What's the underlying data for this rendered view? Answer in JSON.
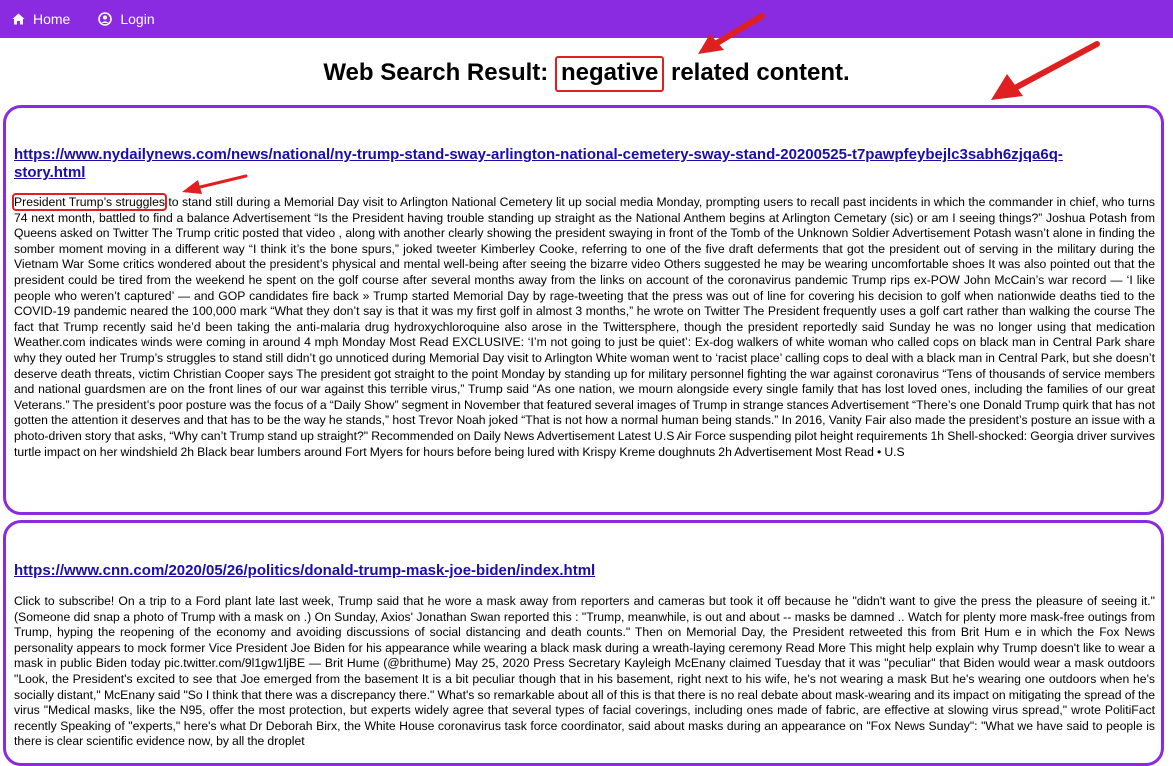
{
  "nav": {
    "home_label": "Home",
    "login_label": "Login",
    "bg_color": "#8a2be2"
  },
  "title": {
    "prefix": "Web Search Result: ",
    "keyword": "negative",
    "suffix": " related content."
  },
  "results": [
    {
      "url": "https://www.nydailynews.com/news/national/ny-trump-stand-sway-arlington-national-cemetery-sway-stand-20200525-t7pawpfeybejlc3sabh6zjqa6q-story.html",
      "snippet_highlight": "President Trump’s struggles",
      "snippet_rest": " to stand still during a Memorial Day visit to Arlington National Cemetery lit up social media Monday, prompting users to recall past incidents in which the commander in chief, who turns 74 next month, battled to find a balance Advertisement “Is the President having trouble standing up straight as the National Anthem begins at Arlington Cemetary (sic) or am I seeing things?” Joshua Potash from Queens asked on Twitter The Trump critic posted that video , along with another clearly showing the president swaying in front of the Tomb of the Unknown Soldier Advertisement Potash wasn’t alone in finding the somber moment moving in a different way “I think it’s the bone spurs,” joked tweeter Kimberley Cooke, referring to one of the five draft deferments that got the president out of serving in the military during the Vietnam War Some critics wondered about the president’s physical and mental well-being after seeing the bizarre video Others suggested he may be wearing uncomfortable shoes It was also pointed out that the president could be tired from the weekend he spent on the golf course after several months away from the links on account of the coronavirus pandemic Trump rips ex-POW John McCain’s war record — ‘I like people who weren’t captured’ — and GOP candidates fire back » Trump started Memorial Day by rage-tweeting that the press was out of line for covering his decision to golf when nationwide deaths tied to the COVID-19 pandemic neared the 100,000 mark “What they don’t say is that it was my first golf in almost 3 months,” he wrote on Twitter The President frequently uses a golf cart rather than walking the course The fact that Trump recently said he’d been taking the anti-malaria drug hydroxychloroquine also arose in the Twittersphere, though the president reportedly said Sunday he was no longer using that medication Weather.com indicates winds were coming in around 4 mph Monday Most Read EXCLUSIVE: ‘I’m not going to just be quiet’: Ex-dog walkers of white woman who called cops on black man in Central Park share why they outed her Trump’s struggles to stand still didn’t go unnoticed during Memorial Day visit to Arlington White woman went to ‘racist place’ calling cops to deal with a black man in Central Park, but she doesn’t deserve death threats, victim Christian Cooper says The president got straight to the point Monday by standing up for military personnel fighting the war against coronavirus “Tens of thousands of service members and national guardsmen are on the front lines of our war against this terrible virus,” Trump said “As one nation, we mourn alongside every single family that has lost loved ones, including the families of our great Veterans.” The president’s poor posture was the focus of a “Daily Show” segment in November that featured several images of Trump in strange stances Advertisement “There’s one Donald Trump quirk that has not gotten the attention it deserves and that has to be the way he stands,” host Trevor Noah joked “That is not how a normal human being stands.” In 2016, Vanity Fair also made the president’s posture an issue with a photo-driven story that asks, “Why can’t Trump stand up straight?\" Recommended on Daily News Advertisement Latest U.S Air Force suspending pilot height requirements 1h Shell-shocked: Georgia driver survives turtle impact on her windshield 2h Black bear lumbers around Fort Myers for hours before being lured with Krispy Kreme doughnuts 2h Advertisement Most Read • U.S"
    },
    {
      "url": "https://www.cnn.com/2020/05/26/politics/donald-trump-mask-joe-biden/index.html",
      "snippet": "Click to subscribe! On a trip to a Ford plant late last week, Trump said that he wore a mask away from reporters and cameras but took it off because he \"didn't want to give the press the pleasure of seeing it.\" (Someone did snap a photo of Trump with a mask on .) On Sunday, Axios' Jonathan Swan reported this : \"Trump, meanwhile, is out and about -- masks be damned .. Watch for plenty more mask-free outings from Trump, hyping the reopening of the economy and avoiding discussions of social distancing and death counts.\" Then on Memorial Day, the President retweeted this from Brit Hum e in which the Fox News personality appears to mock former Vice President Joe Biden for his appearance while wearing a black mask during a wreath-laying ceremony Read More This might help explain why Trump doesn't like to wear a mask in public Biden today pic.twitter.com/9l1gw1ljBE — Brit Hume (@brithume) May 25, 2020 Press Secretary Kayleigh McEnany claimed Tuesday that it was \"peculiar\" that Biden would wear a mask outdoors \"Look, the President's excited to see that Joe emerged from the basement It is a bit peculiar though that in his basement, right next to his wife, he's not wearing a mask But he's wearing one outdoors when he's socially distant,\" McEnany said \"So I think that there was a discrepancy there.\" What's so remarkable about all of this is that there is no real debate about mask-wearing and its impact on mitigating the spread of the virus \"Medical masks, like the N95, offer the most protection, but experts widely agree that several types of facial coverings, including ones made of fabric, are effective at slowing virus spread,\" wrote PolitiFact recently Speaking of \"experts,\" here's what Dr Deborah Birx, the White House coronavirus task force coordinator, said about masks during an appearance on \"Fox News Sunday\": \"What we have said to people is there is clear scientific evidence now, by all the droplet"
    }
  ],
  "colors": {
    "accent": "#8a2be2",
    "link": "#1a0dab",
    "annotation_red": "#e02020"
  }
}
